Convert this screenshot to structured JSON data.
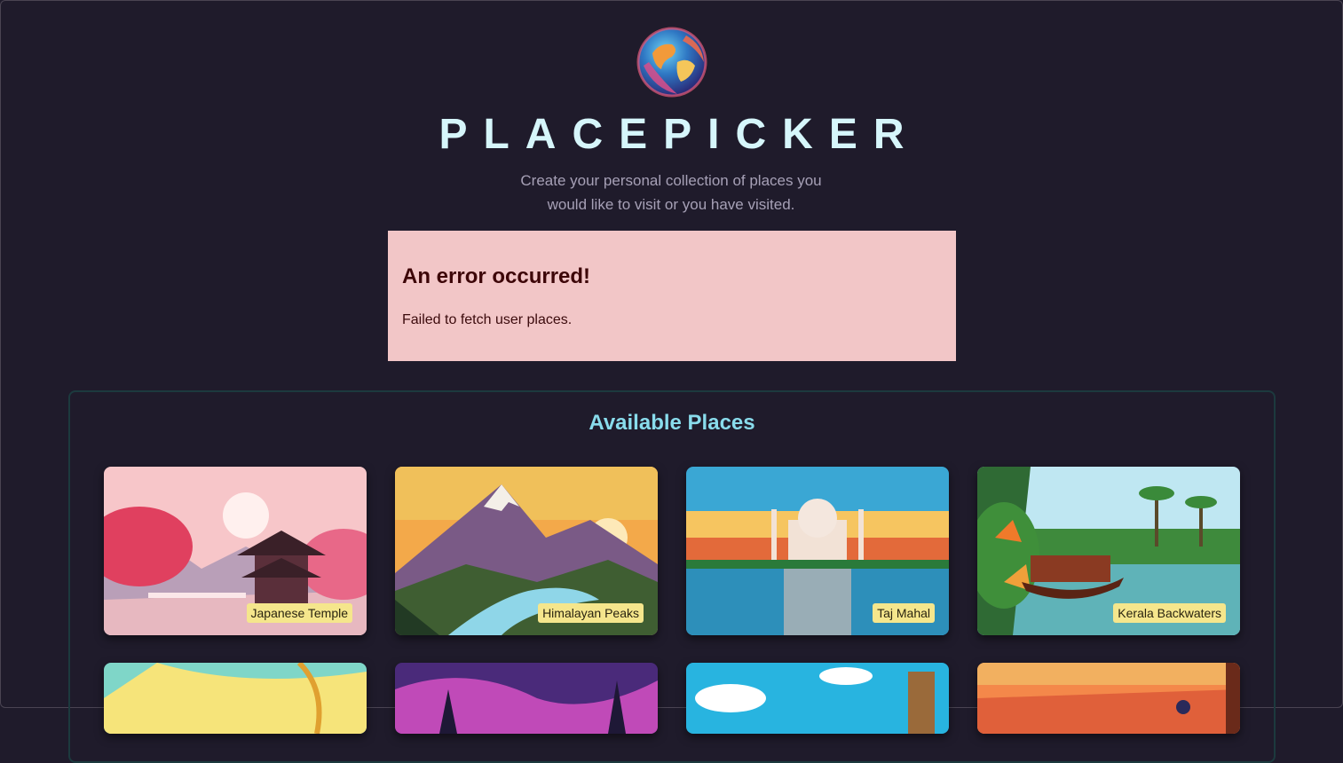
{
  "app": {
    "title": "PLACEPICKER",
    "subtitle_line1": "Create your personal collection of places you",
    "subtitle_line2": "would like to visit or you have visited."
  },
  "error": {
    "title": "An error occurred!",
    "message": "Failed to fetch user places."
  },
  "available_places": {
    "heading": "Available Places",
    "cards": [
      {
        "label": "Japanese Temple",
        "icon": "japanese-temple-image"
      },
      {
        "label": "Himalayan Peaks",
        "icon": "himalayan-peaks-image"
      },
      {
        "label": "Taj Mahal",
        "icon": "taj-mahal-image"
      },
      {
        "label": "Kerala Backwaters",
        "icon": "kerala-backwaters-image"
      }
    ]
  },
  "colors": {
    "background": "#1f1b2b",
    "title": "#d6f6fb",
    "error_bg": "#f2c6c7",
    "accent": "#89dcec",
    "label_bg": "#f5e68c"
  }
}
